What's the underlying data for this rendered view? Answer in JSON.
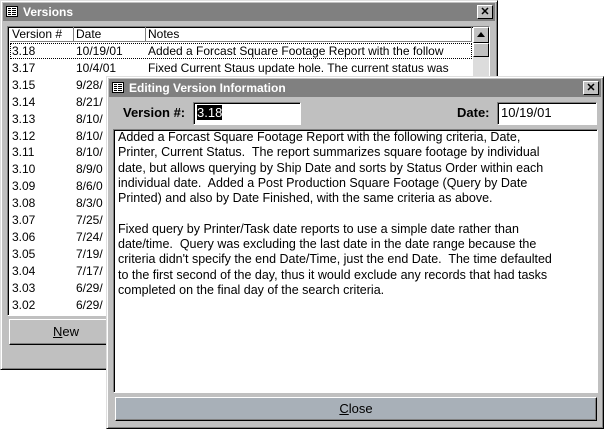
{
  "versions_window": {
    "title": "Versions",
    "close_label": "✕",
    "columns": [
      "Version #",
      "Date",
      "Notes"
    ],
    "rows": [
      {
        "version": "3.18",
        "date": "10/19/01",
        "notes": "Added a Forcast Square Footage Report with the follow"
      },
      {
        "version": "3.17",
        "date": "10/4/01",
        "notes": "Fixed Current Staus update hole.  The current status was"
      },
      {
        "version": "3.15",
        "date": "9/28/",
        "notes": ""
      },
      {
        "version": "3.14",
        "date": "8/21/",
        "notes": ""
      },
      {
        "version": "3.13",
        "date": "8/10/",
        "notes": ""
      },
      {
        "version": "3.12",
        "date": "8/10/",
        "notes": ""
      },
      {
        "version": "3.11",
        "date": "8/10/",
        "notes": ""
      },
      {
        "version": "3.10",
        "date": "8/9/0",
        "notes": ""
      },
      {
        "version": "3.09",
        "date": "8/6/0",
        "notes": ""
      },
      {
        "version": "3.08",
        "date": "8/3/0",
        "notes": ""
      },
      {
        "version": "3.07",
        "date": "7/25/",
        "notes": ""
      },
      {
        "version": "3.06",
        "date": "7/24/",
        "notes": ""
      },
      {
        "version": "3.05",
        "date": "7/19/",
        "notes": ""
      },
      {
        "version": "3.04",
        "date": "7/17/",
        "notes": ""
      },
      {
        "version": "3.03",
        "date": "6/29/",
        "notes": ""
      },
      {
        "version": "3.02",
        "date": "6/29/",
        "notes": ""
      }
    ],
    "new_button": "New",
    "new_button_accel": "N",
    "new_button_rest": "ew"
  },
  "edit_window": {
    "title": "Editing Version Information",
    "close_label": "✕",
    "version_label": "Version #:",
    "version_value": "3.18",
    "date_label": "Date:",
    "date_value": "10/19/01",
    "notes_text": "Added a Forcast Square Footage Report with the following criteria, Date,\nPrinter, Current Status.  The report summarizes square footage by individual\ndate, but allows querying by Ship Date and sorts by Status Order within each\nindividual date.  Added a Post Production Square Footage (Query by Date\nPrinted) and also by Date Finished, with the same criteria as above.\n\nFixed query by Printer/Task date reports to use a simple date rather than\ndate/time.  Query was excluding the last date in the date range because the\ncriteria didn't specify the end Date/Time, just the end Date.  The time defaulted\nto the first second of the day, thus it would exclude any records that had tasks\ncompleted on the final day of the search criteria.",
    "close_button": "Close",
    "close_button_accel": "C",
    "close_button_rest": "lose"
  },
  "colors": {
    "titlebar_inactive": "#808080",
    "face": "#c0c0c0",
    "highlight": "#000000"
  },
  "icons": {
    "window_icon": "form-icon",
    "scroll_up": "arrow-up-icon"
  }
}
